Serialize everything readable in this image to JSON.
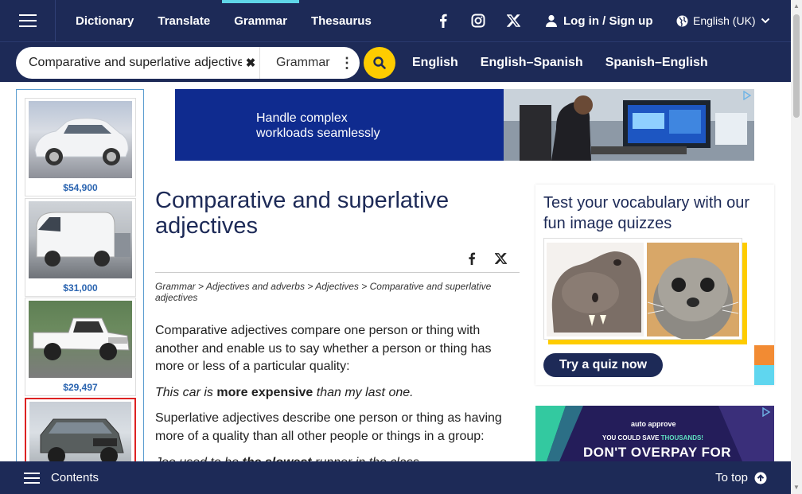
{
  "nav": {
    "tabs": [
      "Dictionary",
      "Translate",
      "Grammar",
      "Thesaurus"
    ],
    "active_tab": "Grammar",
    "login_label": "Log in / Sign up",
    "language_label": "English (UK)"
  },
  "search": {
    "value": "Comparative and superlative adjectives",
    "dictionary": "Grammar",
    "links": [
      "English",
      "English–Spanish",
      "Spanish–English"
    ]
  },
  "left_ads": {
    "prices": [
      "$54,900",
      "$31,000",
      "$29,497"
    ]
  },
  "banner": {
    "line1": "Handle complex",
    "line2": "workloads seamlessly"
  },
  "article": {
    "title": "Comparative and superlative adjectives",
    "breadcrumb": [
      "Grammar",
      "Adjectives and adverbs",
      "Adjectives",
      "Comparative and superlative adjectives"
    ],
    "p1": "Comparative adjectives compare one person or thing with another and enable us to say whether a person or thing has more or less of a particular quality:",
    "ex1_a": "This car is ",
    "ex1_b": "more expensive",
    "ex1_c": " than my last one.",
    "p2": "Superlative adjectives describe one person or thing as having more of a quality than all other people or things in a group:",
    "ex2_a": "Joe used to be ",
    "ex2_b": "the slowest",
    "ex2_c": " runner in the class."
  },
  "quiz": {
    "title": "Test your vocabulary with our fun image quizzes",
    "button": "Try a quiz now"
  },
  "ad2": {
    "brand": "auto approve",
    "save_a": "YOU COULD SAVE ",
    "save_b": "THOUSANDS!",
    "headline": "DON'T OVERPAY FOR"
  },
  "bottom": {
    "contents_label": "Contents",
    "top_label": "To top"
  },
  "colors": {
    "navy": "#1d2a57",
    "yellow": "#fecc00",
    "cyan": "#5fd6e8",
    "price_blue": "#2a64b0"
  }
}
